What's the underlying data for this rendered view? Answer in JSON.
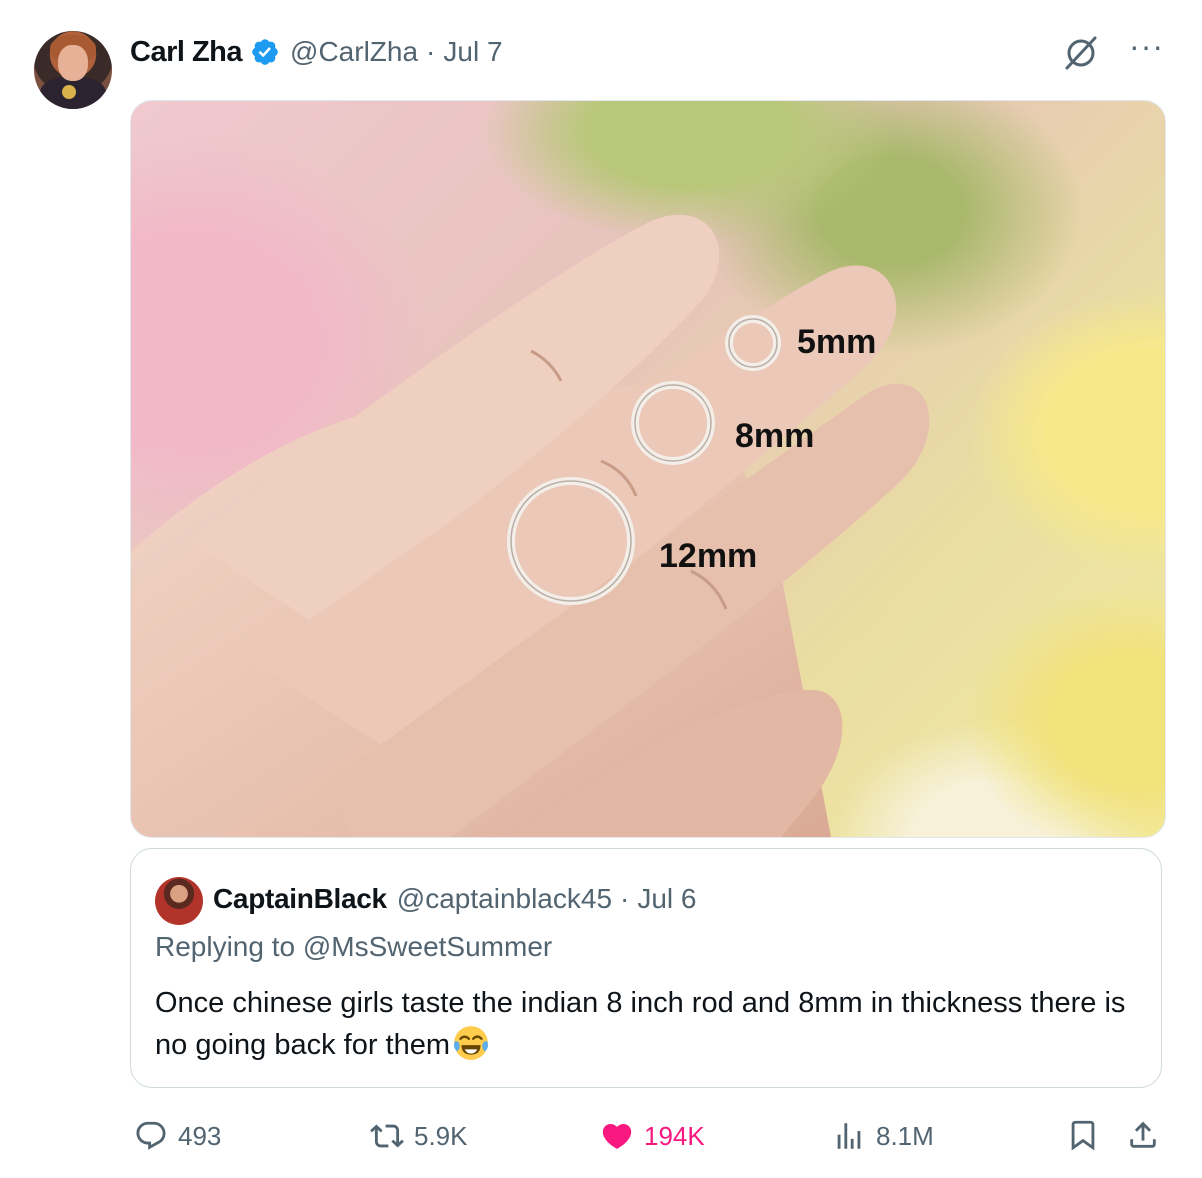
{
  "author": {
    "name": "Carl Zha",
    "handle": "@CarlZha",
    "separator": "·",
    "date": "Jul 7",
    "verified": true
  },
  "media": {
    "ring_labels": [
      "5mm",
      "8mm",
      "12mm"
    ]
  },
  "quoted": {
    "name": "CaptainBlack",
    "handle": "@captainblack45",
    "separator": "·",
    "date": "Jul 6",
    "replying_to": "Replying to @MsSweetSummer",
    "text": "Once chinese girls taste the indian 8 inch rod and 8mm in thickness there is no going back for them",
    "emoji": "face-with-tears-of-joy"
  },
  "metrics": {
    "replies": "493",
    "reposts": "5.9K",
    "likes": "194K",
    "views": "8.1M"
  },
  "colors": {
    "verified": "#1d9bf0",
    "like": "#f91880",
    "muted": "#536471"
  },
  "icons": [
    "verified-badge-icon",
    "grok-icon",
    "more-icon",
    "reply-icon",
    "repost-icon",
    "like-icon",
    "views-icon",
    "bookmark-icon",
    "share-icon"
  ]
}
